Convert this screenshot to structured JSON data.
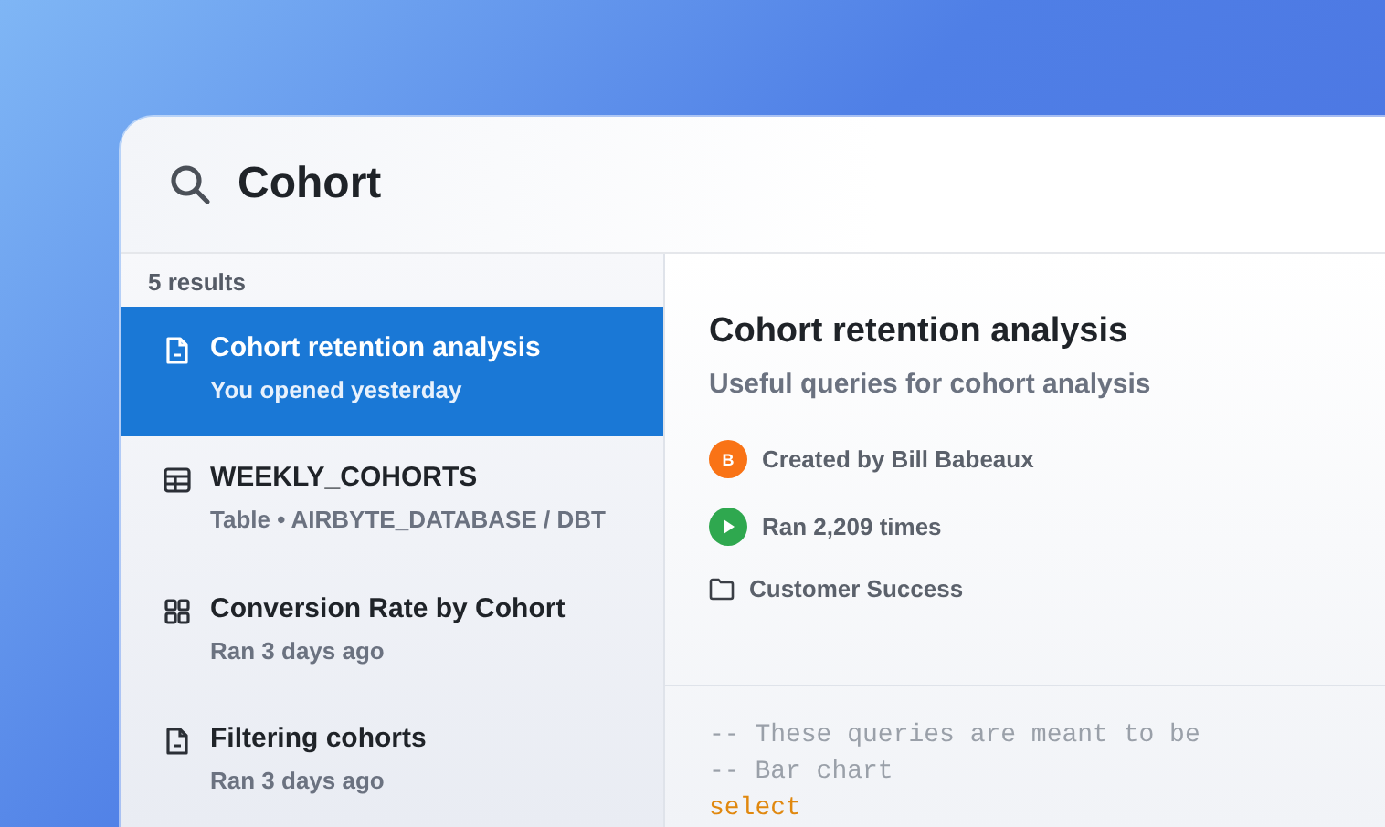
{
  "search": {
    "value": "Cohort"
  },
  "results_count": "5 results",
  "results": [
    {
      "kind": "document",
      "title": "Cohort retention analysis",
      "subtitle": "You opened yesterday",
      "selected": true
    },
    {
      "kind": "table",
      "title": "WEEKLY_COHORTS",
      "subtitle": "Table • AIRBYTE_DATABASE / DBT",
      "selected": false
    },
    {
      "kind": "dashboard",
      "title": "Conversion Rate by Cohort",
      "subtitle": "Ran 3 days ago",
      "selected": false
    },
    {
      "kind": "document",
      "title": "Filtering cohorts",
      "subtitle": "Ran 3 days ago",
      "selected": false
    }
  ],
  "detail": {
    "title": "Cohort retention analysis",
    "description": "Useful queries for cohort analysis",
    "meta": [
      {
        "kind": "avatar",
        "initial": "B",
        "text": "Created by Bill Babeaux",
        "color": "#f97316"
      },
      {
        "kind": "runs",
        "text": "Ran 2,209 times",
        "color": "#2fa84f"
      },
      {
        "kind": "folder",
        "text": "Customer Success"
      }
    ],
    "code": [
      {
        "kind": "comment",
        "text": "-- These queries are meant to be"
      },
      {
        "kind": "comment",
        "text": "-- Bar chart"
      },
      {
        "kind": "keyword",
        "text": "select"
      }
    ]
  }
}
